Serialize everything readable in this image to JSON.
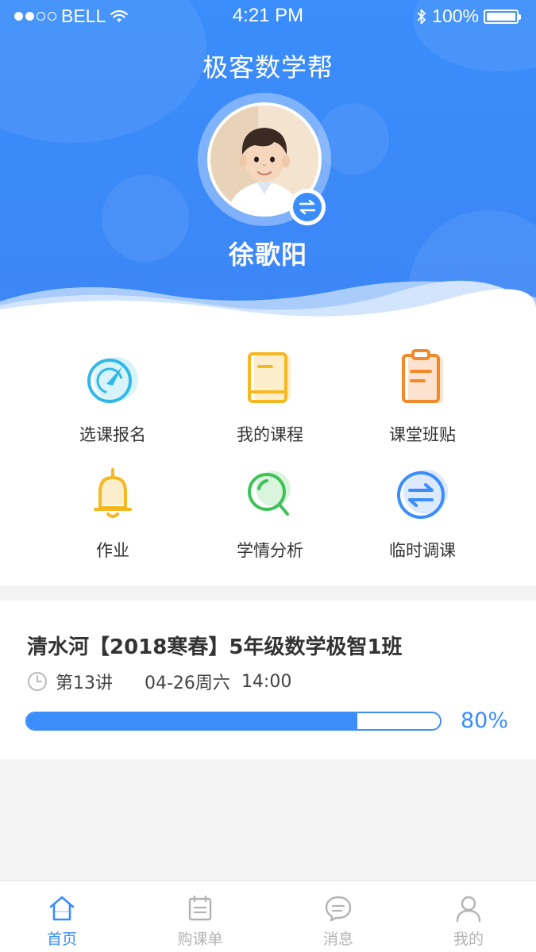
{
  "statusbar": {
    "carrier": "BELL",
    "time": "4:21 PM",
    "battery": "100%"
  },
  "header": {
    "title": "极客数学帮",
    "username": "徐歌阳"
  },
  "menu": [
    {
      "label": "选课报名",
      "icon": "compass-icon"
    },
    {
      "label": "我的课程",
      "icon": "book-icon"
    },
    {
      "label": "课堂班贴",
      "icon": "clipboard-icon"
    },
    {
      "label": "作业",
      "icon": "bell-icon"
    },
    {
      "label": "学情分析",
      "icon": "magnifier-icon"
    },
    {
      "label": "临时调课",
      "icon": "swap-icon"
    }
  ],
  "course": {
    "title": "清水河【2018寒春】5年级数学极智1班",
    "lecture": "第13讲",
    "date": "04-26周六",
    "time": "14:00",
    "progress": 0.8,
    "progress_label": "80%"
  },
  "tabs": [
    {
      "label": "首页",
      "icon": "home-icon",
      "active": true
    },
    {
      "label": "购课单",
      "icon": "calendar-icon",
      "active": false
    },
    {
      "label": "消息",
      "icon": "chat-icon",
      "active": false
    },
    {
      "label": "我的",
      "icon": "user-icon",
      "active": false
    }
  ],
  "colors": {
    "accent": "#3a8dfb",
    "compass": "#2fb8e8",
    "book": "#f5b822",
    "clipboard": "#f08a2d",
    "bell": "#f5b822",
    "magnifier": "#3fc25a",
    "swap": "#3a8dfb"
  }
}
